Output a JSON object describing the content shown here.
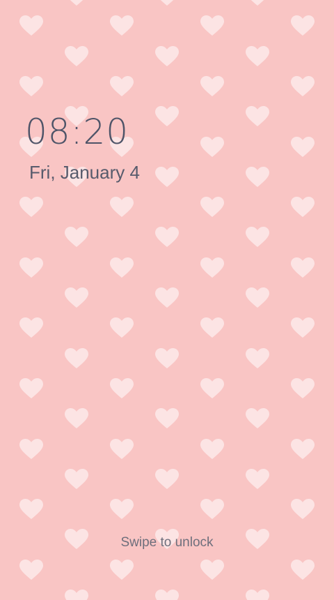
{
  "lockscreen": {
    "time": "08:20",
    "date": "Fri, January 4",
    "swipe_hint": "Swipe to unlock"
  },
  "wallpaper": {
    "pattern_icon": "heart-icon",
    "background_color": "#f9c5c4",
    "heart_color": "#ffffff"
  }
}
